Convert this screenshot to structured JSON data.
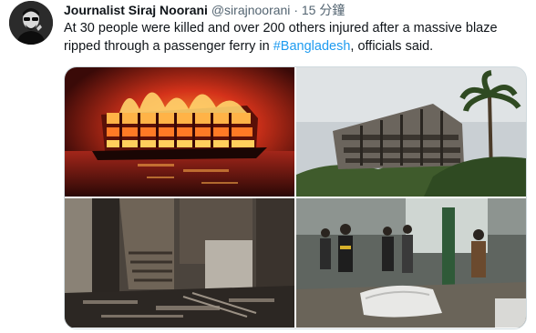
{
  "tweet": {
    "display_name": "Journalist Siraj Noorani",
    "handle": "@sirajnoorani",
    "separator": "·",
    "time": "15 分鐘",
    "text_before": "At 30 people were killed and over 200 others injured after a massive blaze ripped through a passenger ferry in ",
    "hashtag": "#Bangladesh",
    "text_after": ", officials said.",
    "colors": {
      "text": "#0f1419",
      "secondary": "#536471",
      "link": "#1d9bf0"
    }
  },
  "media": {
    "photos": [
      {
        "icon": "burning-ferry-night-photo"
      },
      {
        "icon": "burnt-ferry-daylight-photo"
      },
      {
        "icon": "charred-interior-photo"
      },
      {
        "icon": "rescue-workers-photo"
      }
    ]
  }
}
